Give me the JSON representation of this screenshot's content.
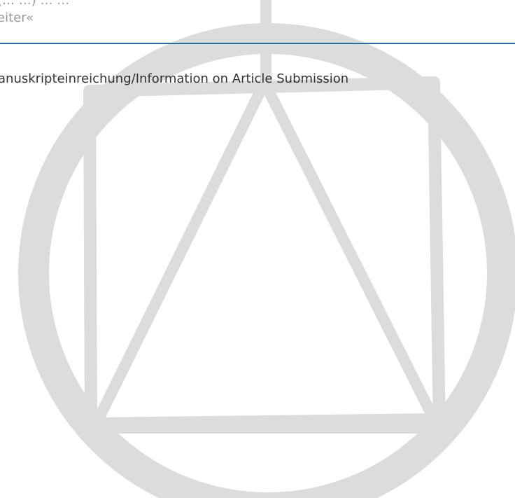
{
  "article": {
    "intro_text_line1": "(… …) … …",
    "intro_text_line2": "eiter«"
  },
  "submission_link": {
    "label": "anuskripteinreichung/Information on Article Submission"
  },
  "colors": {
    "divider": "#2b6e9a",
    "watermark": "#dcdcdc",
    "body_text": "#333333",
    "muted_text": "#9a9a9a"
  },
  "watermark": {
    "icon": "triangle-square-circle-icon"
  }
}
